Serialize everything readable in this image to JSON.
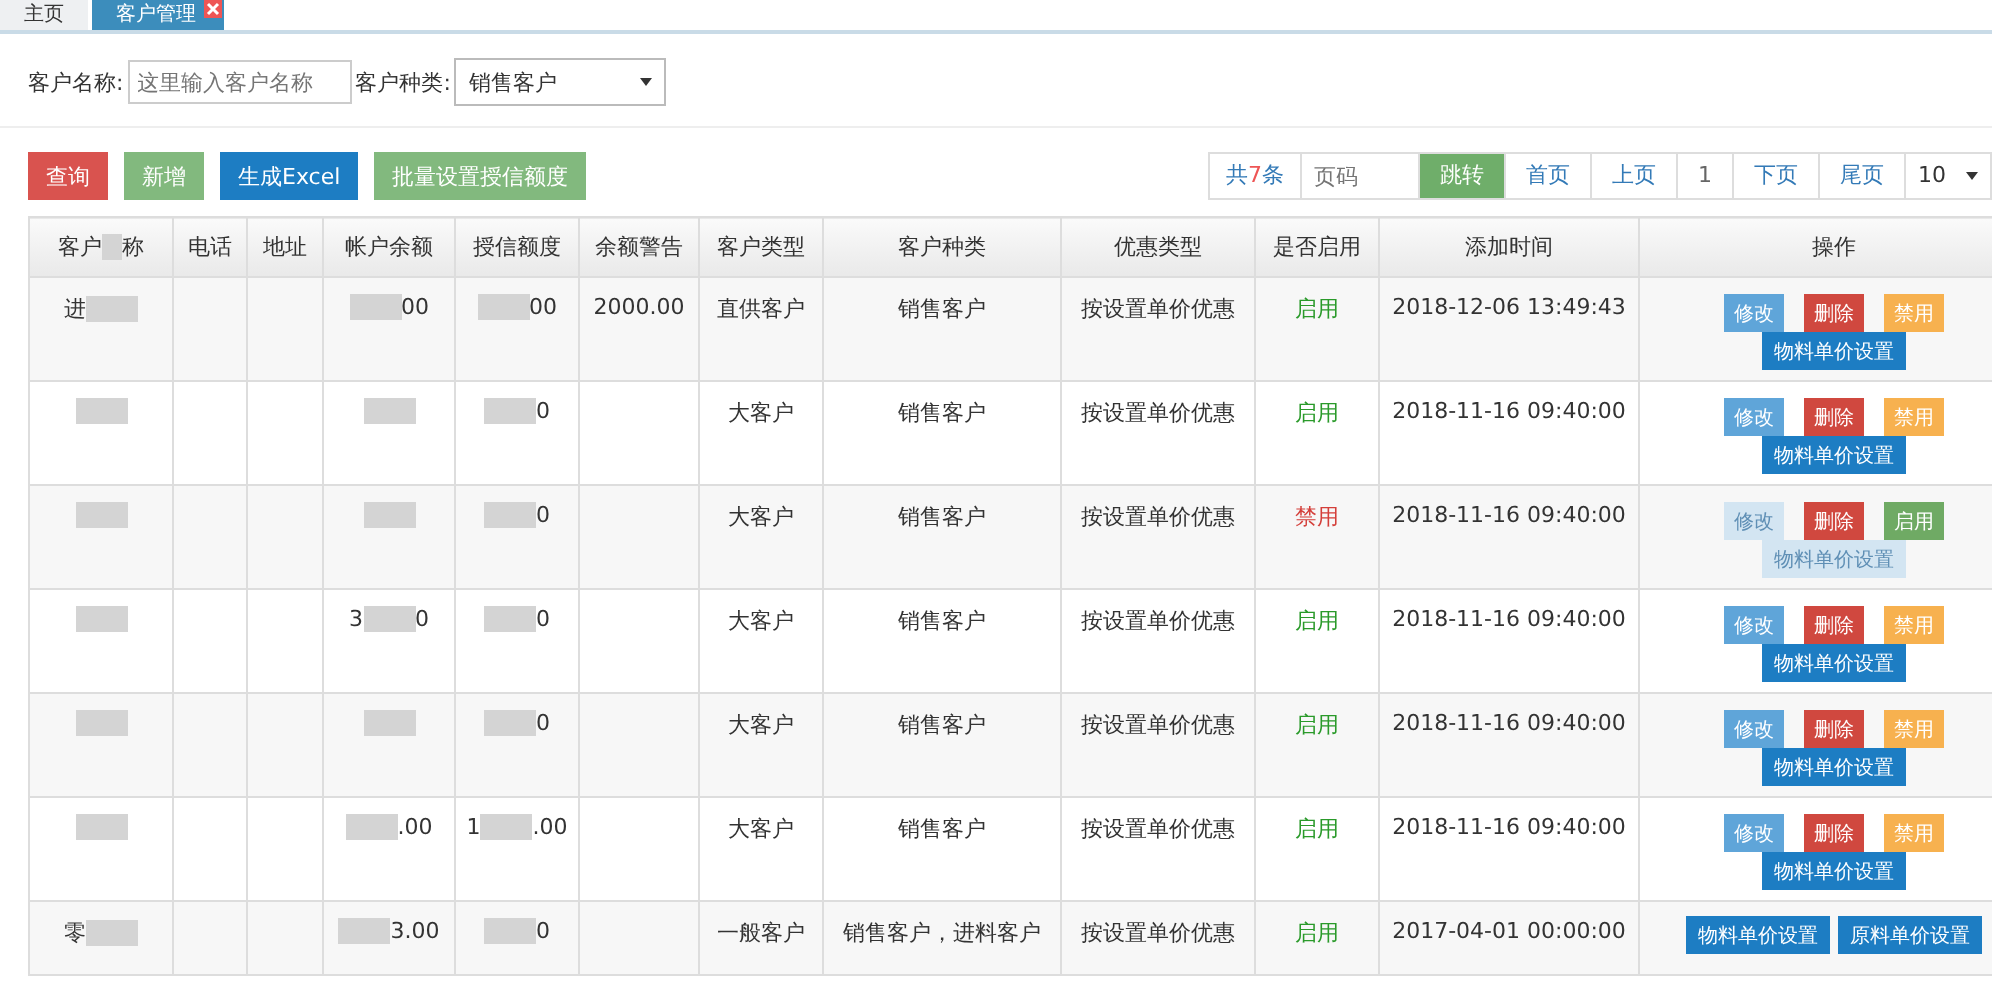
{
  "tabs": [
    {
      "label": "主页",
      "selected": false,
      "closable": false
    },
    {
      "label": "客户管理",
      "selected": true,
      "closable": true
    }
  ],
  "filters": {
    "name_label": "客户名称:",
    "name_placeholder": "这里输入客户名称",
    "category_label": "客户种类:",
    "category_value": "销售客户"
  },
  "actions": [
    {
      "label": "查询",
      "kind": "danger"
    },
    {
      "label": "新增",
      "kind": "success"
    },
    {
      "label": "生成Excel",
      "kind": "primary"
    },
    {
      "label": "批量设置授信额度",
      "kind": "success"
    }
  ],
  "pagination": {
    "total_prefix": "共",
    "total_count": "7",
    "total_suffix": "条",
    "page_placeholder": "页码",
    "jump": "跳转",
    "first": "首页",
    "prev": "上页",
    "current": "1",
    "next": "下页",
    "last": "尾页",
    "page_size": "10"
  },
  "table": {
    "columns": [
      "客户",
      "电话",
      "地址",
      "帐户余额",
      "授信额度",
      "余额警告",
      "客户类型",
      "客户种类",
      "优惠类型",
      "是否启用",
      "添加时间",
      "操作"
    ],
    "header_redacted": "称",
    "rows": [
      {
        "name": {
          "pre": "进",
          "redacted": true
        },
        "balance": {
          "post": "00",
          "redacted": true
        },
        "credit": {
          "post": "00",
          "redacted": true
        },
        "warning": "2000.00",
        "type": "直供客户",
        "category": "销售客户",
        "discount": "按设置单价优惠",
        "status": {
          "text": "启用",
          "enabled": true
        },
        "time": "2018-12-06 13:49:43",
        "buttons": [
          {
            "label": "修改",
            "kind": "edit",
            "disabled": false
          },
          {
            "label": "删除",
            "kind": "delete",
            "disabled": false
          },
          {
            "label": "禁用",
            "kind": "disable",
            "disabled": false
          },
          {
            "label": "物料单价设置",
            "kind": "price",
            "disabled": false
          }
        ]
      },
      {
        "name": {
          "redacted": true
        },
        "balance": {
          "redacted": true
        },
        "credit": {
          "post": "0",
          "redacted": true
        },
        "type": "大客户",
        "category": "销售客户",
        "discount": "按设置单价优惠",
        "status": {
          "text": "启用",
          "enabled": true
        },
        "time": "2018-11-16 09:40:00",
        "buttons": [
          {
            "label": "修改",
            "kind": "edit",
            "disabled": false
          },
          {
            "label": "删除",
            "kind": "delete",
            "disabled": false
          },
          {
            "label": "禁用",
            "kind": "disable",
            "disabled": false
          },
          {
            "label": "物料单价设置",
            "kind": "price",
            "disabled": false
          }
        ]
      },
      {
        "name": {
          "redacted": true
        },
        "balance": {
          "redacted": true
        },
        "credit": {
          "post": "0",
          "redacted": true
        },
        "type": "大客户",
        "category": "销售客户",
        "discount": "按设置单价优惠",
        "status": {
          "text": "禁用",
          "enabled": false
        },
        "time": "2018-11-16 09:40:00",
        "buttons": [
          {
            "label": "修改",
            "kind": "edit",
            "disabled": true
          },
          {
            "label": "删除",
            "kind": "delete",
            "disabled": false
          },
          {
            "label": "启用",
            "kind": "enable",
            "disabled": false
          },
          {
            "label": "物料单价设置",
            "kind": "price",
            "disabled": true
          }
        ]
      },
      {
        "name": {
          "redacted": true
        },
        "balance": {
          "pre": "3",
          "post": "0",
          "redacted": true
        },
        "credit": {
          "post": "0",
          "redacted": true
        },
        "type": "大客户",
        "category": "销售客户",
        "discount": "按设置单价优惠",
        "status": {
          "text": "启用",
          "enabled": true
        },
        "time": "2018-11-16 09:40:00",
        "buttons": [
          {
            "label": "修改",
            "kind": "edit",
            "disabled": false
          },
          {
            "label": "删除",
            "kind": "delete",
            "disabled": false
          },
          {
            "label": "禁用",
            "kind": "disable",
            "disabled": false
          },
          {
            "label": "物料单价设置",
            "kind": "price",
            "disabled": false
          }
        ]
      },
      {
        "name": {
          "redacted": true
        },
        "balance": {
          "redacted": true
        },
        "credit": {
          "post": "0",
          "redacted": true
        },
        "type": "大客户",
        "category": "销售客户",
        "discount": "按设置单价优惠",
        "status": {
          "text": "启用",
          "enabled": true
        },
        "time": "2018-11-16 09:40:00",
        "buttons": [
          {
            "label": "修改",
            "kind": "edit",
            "disabled": false
          },
          {
            "label": "删除",
            "kind": "delete",
            "disabled": false
          },
          {
            "label": "禁用",
            "kind": "disable",
            "disabled": false
          },
          {
            "label": "物料单价设置",
            "kind": "price",
            "disabled": false
          }
        ]
      },
      {
        "name": {
          "redacted": true
        },
        "balance": {
          "post": ".00",
          "redacted": true
        },
        "credit": {
          "pre": "1",
          "post": ".00",
          "redacted": true
        },
        "type": "大客户",
        "category": "销售客户",
        "discount": "按设置单价优惠",
        "status": {
          "text": "启用",
          "enabled": true
        },
        "time": "2018-11-16 09:40:00",
        "buttons": [
          {
            "label": "修改",
            "kind": "edit",
            "disabled": false
          },
          {
            "label": "删除",
            "kind": "delete",
            "disabled": false
          },
          {
            "label": "禁用",
            "kind": "disable",
            "disabled": false
          },
          {
            "label": "物料单价设置",
            "kind": "price",
            "disabled": false
          }
        ]
      },
      {
        "name": {
          "pre": "零",
          "redacted": true
        },
        "balance": {
          "post": "3.00",
          "redacted": true
        },
        "credit": {
          "post": "0",
          "redacted": true
        },
        "type": "一般客户",
        "category": "销售客户，进料客户",
        "discount": "按设置单价优惠",
        "status": {
          "text": "启用",
          "enabled": true
        },
        "time": "2017-04-01 00:00:00",
        "buttons": [
          {
            "label": "物料单价设置",
            "kind": "price",
            "disabled": false
          },
          {
            "label": "原料单价设置",
            "kind": "material",
            "disabled": false
          }
        ]
      }
    ]
  }
}
